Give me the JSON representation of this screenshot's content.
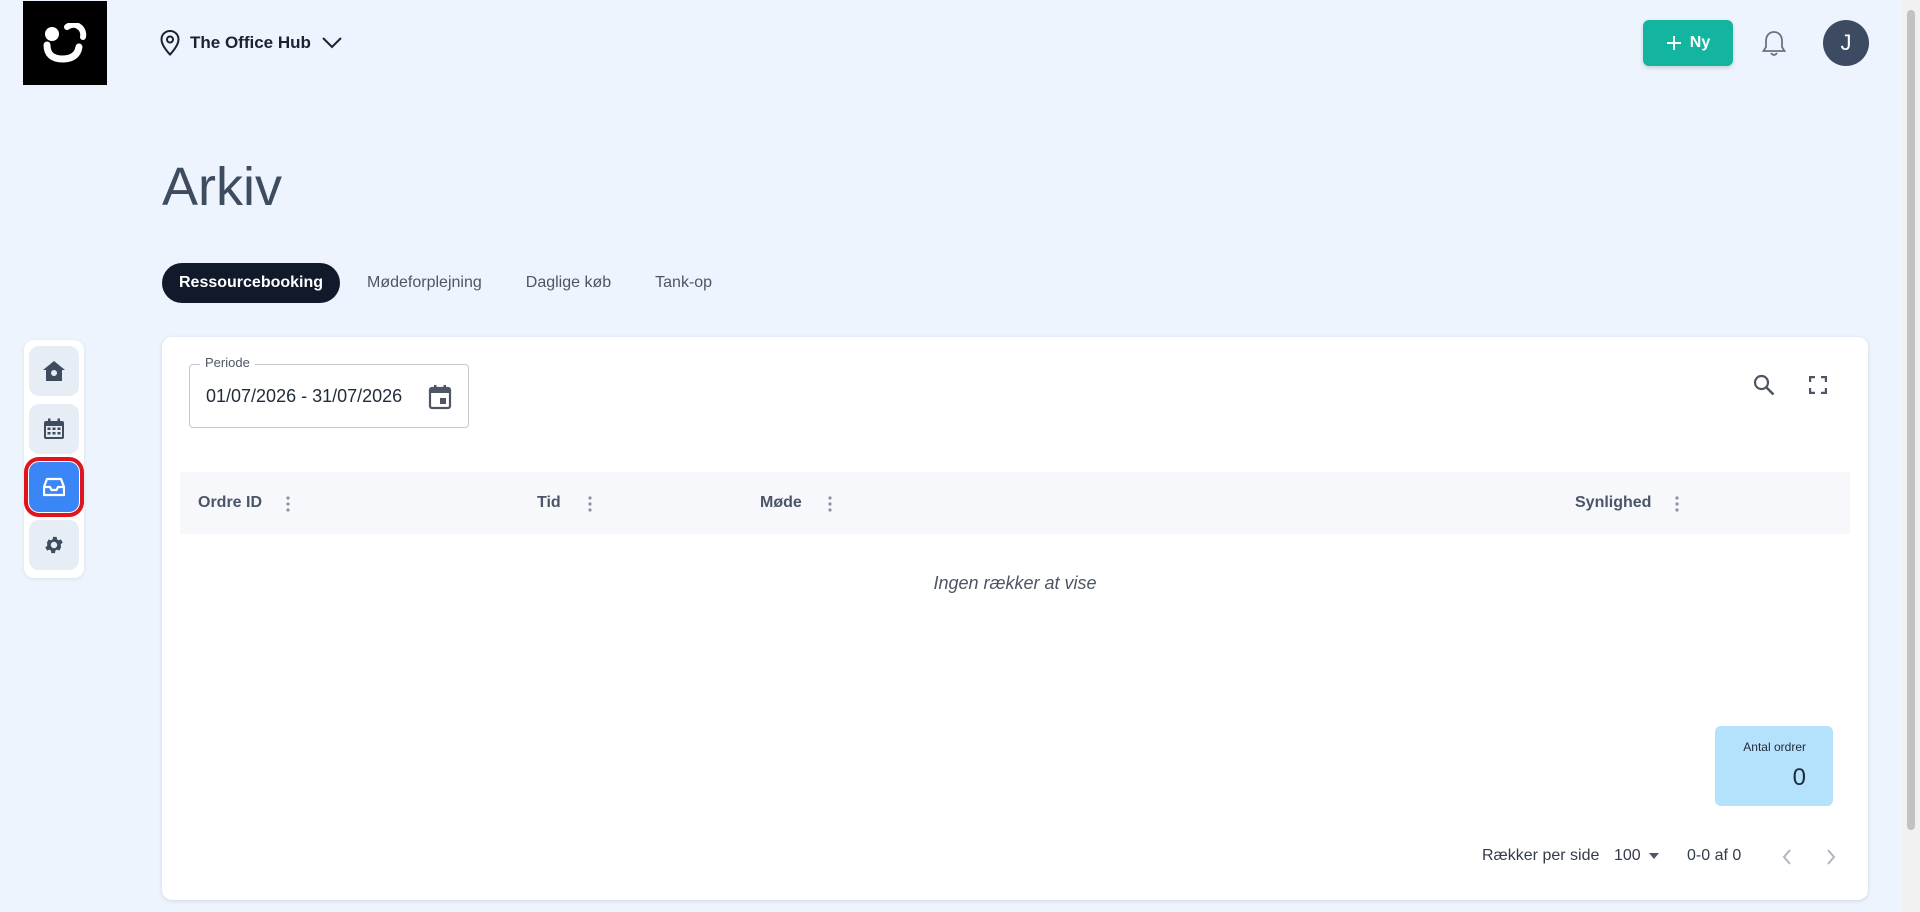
{
  "location": {
    "name": "The Office Hub"
  },
  "header": {
    "new_label": "Ny",
    "avatar_initial": "J"
  },
  "sidebar": {
    "items": [
      {
        "icon": "home-icon",
        "active": false
      },
      {
        "icon": "calendar-icon",
        "active": false
      },
      {
        "icon": "archive-icon",
        "active": true
      },
      {
        "icon": "gear-icon",
        "active": false
      }
    ]
  },
  "page": {
    "title": "Arkiv"
  },
  "tabs": [
    {
      "label": "Ressourcebooking",
      "active": true
    },
    {
      "label": "Mødeforplejning",
      "active": false
    },
    {
      "label": "Daglige køb",
      "active": false
    },
    {
      "label": "Tank-op",
      "active": false
    }
  ],
  "filter": {
    "period_label": "Periode",
    "period_value": "01/07/2026 - 31/07/2026"
  },
  "table": {
    "columns": [
      "Ordre ID",
      "Tid",
      "Møde",
      "Synlighed"
    ],
    "empty_message": "Ingen rækker at vise"
  },
  "summary": {
    "label": "Antal ordrer",
    "value": "0"
  },
  "pagination": {
    "rows_per_page_label": "Rækker per side",
    "rows_per_page": "100",
    "range": "0-0 af 0"
  },
  "colors": {
    "accent": "#14b5a0",
    "active_nav": "#3b86f7",
    "highlight": "#e0141c",
    "tab_active": "#111a2b"
  }
}
